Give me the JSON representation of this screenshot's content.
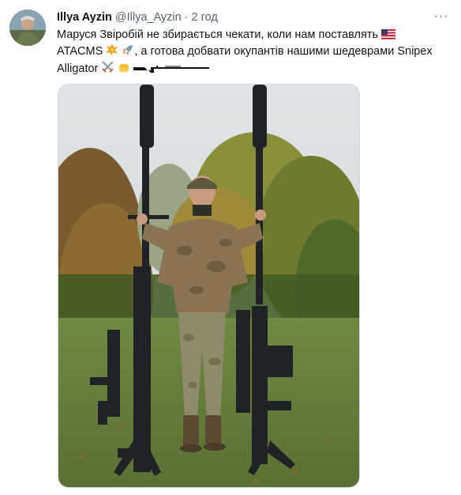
{
  "tweet": {
    "author_name": "Illya Ayzin",
    "handle": "@Illya_Ayzin",
    "separator": "·",
    "time": "2 год",
    "text_line1": "Маруся Звіробій не збирається чекати, коли нам поставлять",
    "text_line2_a": "ATACMS",
    "text_line2_b": ", а готова добвати окупантів нашими шедеврами Snipex",
    "text_line3": "Alligator",
    "more_glyph": "···"
  },
  "icons": {
    "flag": "us-flag-icon",
    "explosion": "collision-icon",
    "rocket": "rocket-icon",
    "swords": "crossed-swords-icon",
    "fist": "fist-icon",
    "rifle": "rifle-icon"
  },
  "colors": {
    "text": "#0f1419",
    "muted": "#536471",
    "border": "#cfd9de"
  }
}
